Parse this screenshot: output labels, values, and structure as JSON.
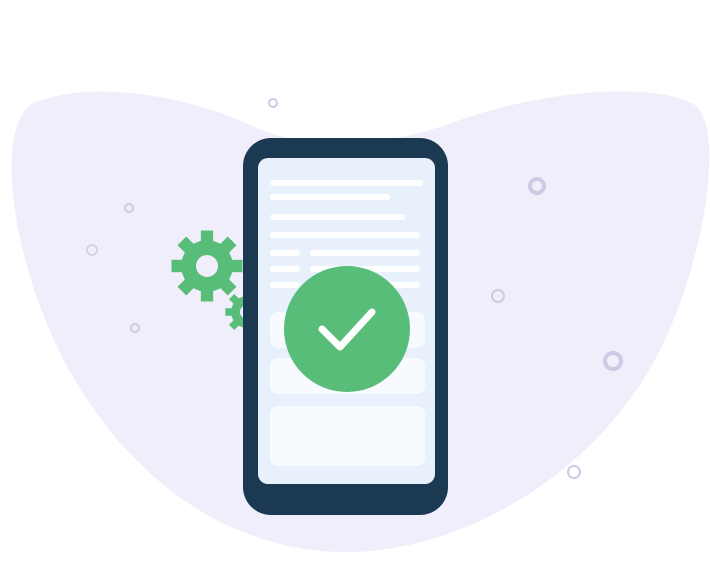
{
  "illustration": {
    "subject": "phone-success-confirmation",
    "icons": [
      "phone-icon",
      "gear-icon",
      "checkmark-icon"
    ]
  },
  "colors": {
    "background": "#ffffff",
    "blob": "#f1eefb",
    "phone_frame": "#1b3a52",
    "phone_screen": "#e8f1fb",
    "screen_lines": "#ffffff",
    "screen_cards": "#f7fafe",
    "success": "#58bd79",
    "check": "#ffffff",
    "gear": "#58bd79",
    "bubble": "#cfc9e6"
  }
}
